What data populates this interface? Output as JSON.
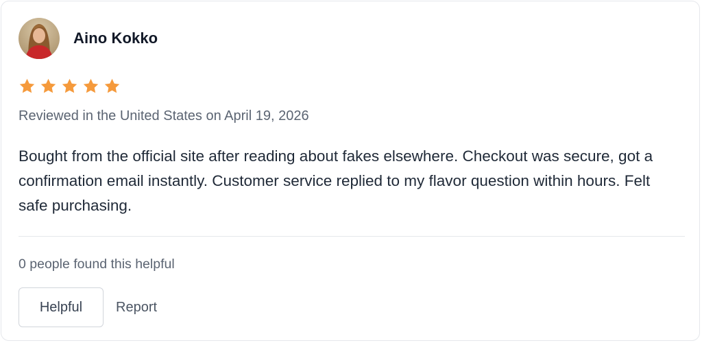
{
  "review": {
    "reviewer_name": "Aino Kokko",
    "avatar_icon": "user-photo-avatar",
    "rating": 5,
    "rating_max": 5,
    "star_color": "#f59a3c",
    "meta": "Reviewed in the United States on April 19, 2026",
    "body": "Bought from the official site after reading about fakes elsewhere. Checkout was secure, got a confirmation email instantly. Customer service replied to my flavor question within hours. Felt safe purchasing.",
    "helpful_count_text": "0 people found this helpful",
    "helpful_button_label": "Helpful",
    "report_button_label": "Report"
  }
}
